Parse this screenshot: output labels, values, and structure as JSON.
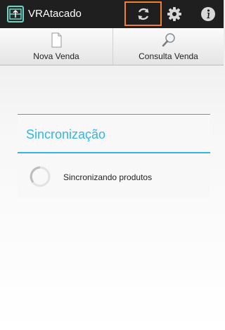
{
  "action_bar": {
    "title": "VRAtacado",
    "icons": [
      "app-logo-icon",
      "sync-icon",
      "gear-icon",
      "info-icon"
    ]
  },
  "top_menu": {
    "items": [
      {
        "label": "Nova Venda",
        "icon": "document-icon"
      },
      {
        "label": "Consulta Venda",
        "icon": "magnifier-icon"
      }
    ]
  },
  "sync_dialog": {
    "title": "Sincronização",
    "status": "Sincronizando produtos"
  },
  "colors": {
    "action_bar_bg": "#1f1f1f",
    "accent_blue": "#33b5e5",
    "highlight_orange": "#f07f2f",
    "logo_teal": "#6fd3c4"
  }
}
